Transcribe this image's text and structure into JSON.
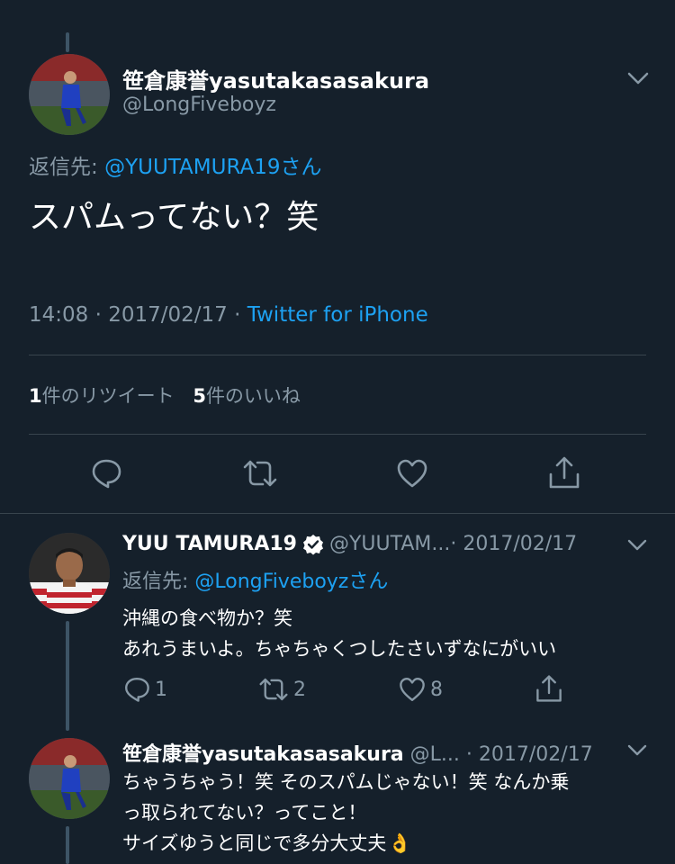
{
  "main_tweet": {
    "display_name": "笹倉康誉yasutakasasakura",
    "handle": "@LongFiveboyz",
    "reply_prefix": "返信先: ",
    "reply_to": "@YUUTAMURA19さん",
    "text": "スパムってない？笑",
    "time": "14:08",
    "sep1": " · ",
    "date": "2017/02/17",
    "sep2": " · ",
    "source": "Twitter for iPhone",
    "retweet_count": "1",
    "retweet_label": "件のリツイート",
    "like_count": "5",
    "like_label": "件のいいね"
  },
  "replies": [
    {
      "display_name": "YUU TAMURA19",
      "handle": "@YUUTAM...",
      "date": " · 2017/02/17",
      "reply_prefix": "返信先: ",
      "reply_to": "@LongFiveboyzさん",
      "text_lines": [
        "沖縄の食べ物か？笑",
        "あれうまいよ。ちゃちゃくつしたさいずなにがいい"
      ],
      "reply_count": "1",
      "retweet_count": "2",
      "like_count": "8"
    },
    {
      "display_name": "笹倉康誉yasutakasasakura",
      "handle": "@L...",
      "date": " · 2017/02/17",
      "text_lines": [
        "ちゃうちゃう！笑 そのスパムじゃない！笑 なんか乗",
        "っ取られてない？ってこと！",
        "サイズゆうと同じで多分大丈夫"
      ],
      "emoji": "👌"
    }
  ],
  "colors": {
    "background": "#15202b",
    "accent": "#1da1f2",
    "muted": "#8899a6",
    "divider": "#38444d"
  },
  "icons": [
    "chevron-down-icon",
    "reply-icon",
    "retweet-icon",
    "like-icon",
    "share-icon",
    "verified-icon",
    "ok-hand-emoji"
  ]
}
